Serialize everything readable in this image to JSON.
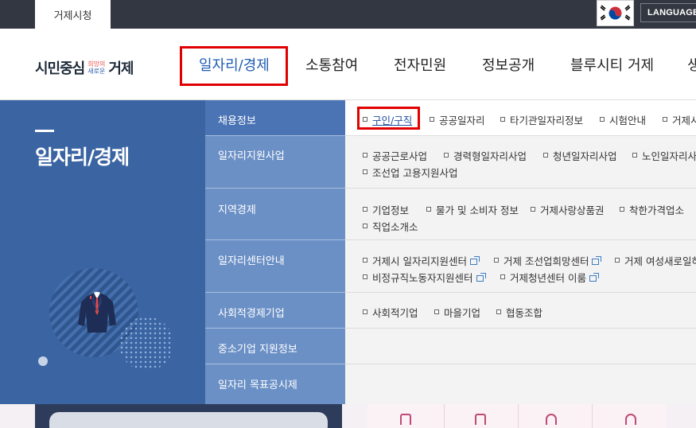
{
  "topbar": {
    "site_tab": "거제시청",
    "language_label": "LANGUAGE",
    "flag_icon": "korea-flag-icon"
  },
  "header": {
    "logo": {
      "main1": "시민중심",
      "slogan1": "희망의",
      "slogan2": "새로운",
      "main2": "거제"
    },
    "nav": [
      "일자리/경제",
      "소통참여",
      "전자민원",
      "정보공개",
      "블루시티 거제",
      "생"
    ]
  },
  "panel": {
    "title": "일자리/경제"
  },
  "menu": [
    {
      "label": "채용정보",
      "items": [
        "구인/구직",
        "공공일자리",
        "타기관일자리정보",
        "시험안내",
        "거제시"
      ]
    },
    {
      "label": "일자리지원사업",
      "items": [
        "공공근로사업",
        "경력형일자리사업",
        "청년일자리사업",
        "노인일자리사",
        "조선업 고용지원사업"
      ]
    },
    {
      "label": "지역경제",
      "items": [
        "기업정보",
        "물가 및 소비자 정보",
        "거제사랑상품권",
        "착한가격업소",
        "직업소개소"
      ]
    },
    {
      "label": "일자리센터안내",
      "items": [
        "거제시 일자리지원센터",
        "거제 조선업희망센터",
        "거제 여성새로일하",
        "비정규직노동자지원센터",
        "거제청년센터 이룸"
      ]
    },
    {
      "label": "사회적경제기업",
      "items": [
        "사회적기업",
        "마을기업",
        "협동조합"
      ]
    },
    {
      "label": "중소기업 지원정보",
      "items": []
    },
    {
      "label": "일자리 목표공시제",
      "items": []
    }
  ],
  "colors": {
    "highlight": "#e10000",
    "panel": "#3a64a2",
    "category": "#6b90c6",
    "topbar": "#323741"
  }
}
